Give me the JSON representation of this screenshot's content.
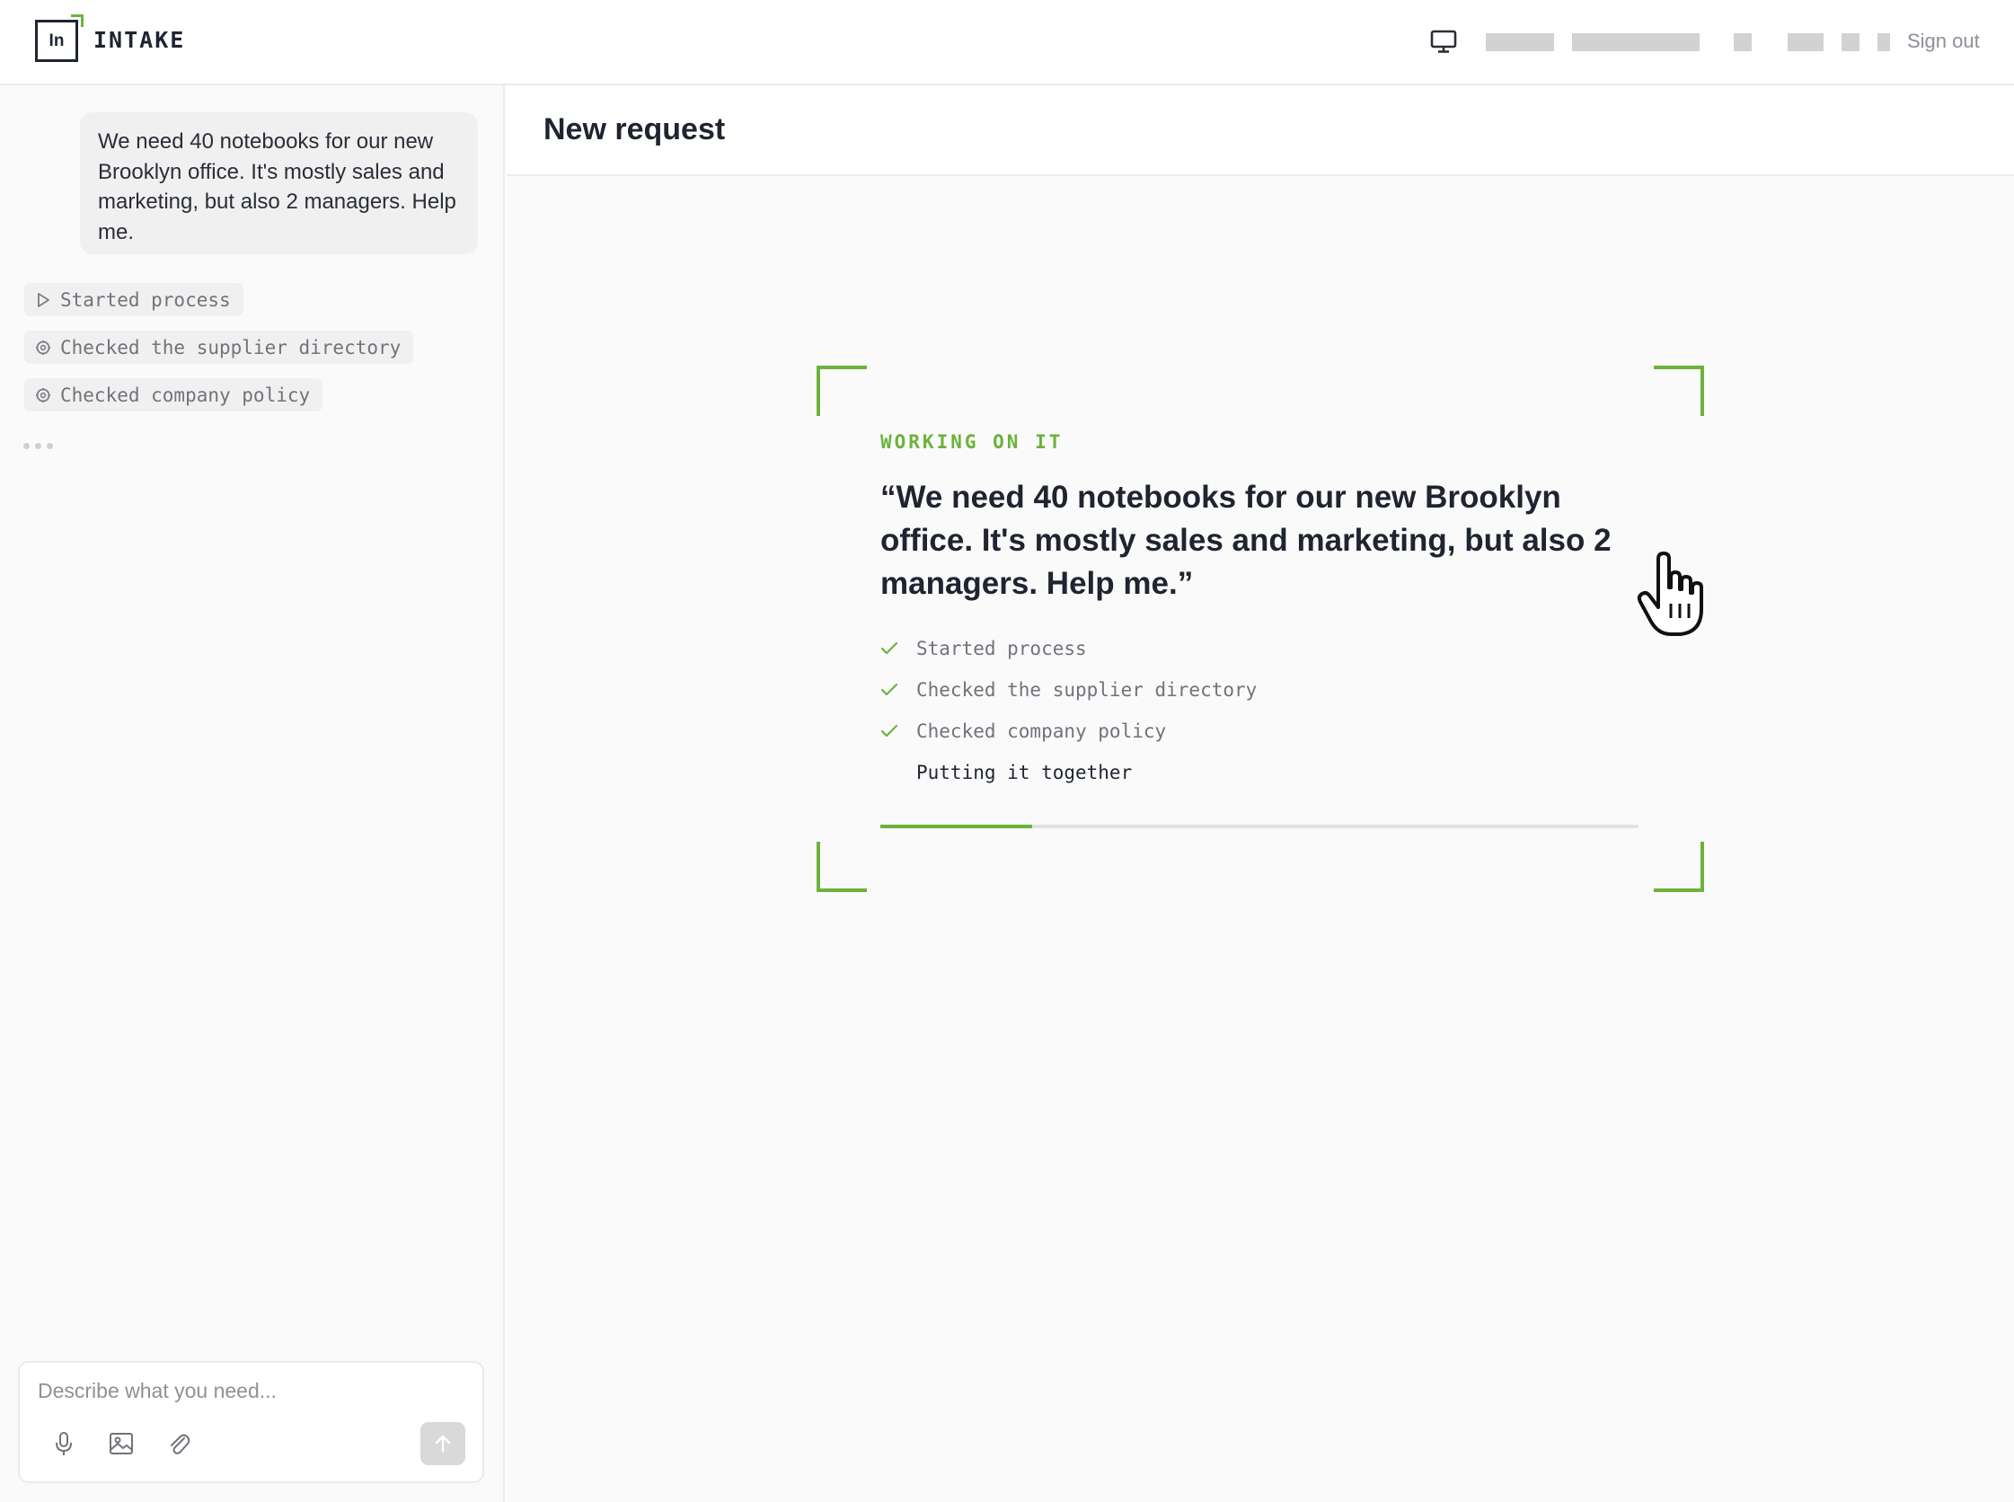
{
  "app": {
    "logo_text": "In",
    "brand": "INTAKE",
    "sign_out": "Sign out",
    "icons": {
      "display": "monitor-icon"
    }
  },
  "sidebar": {
    "user_message": "We need 40 notebooks for our new Brooklyn office. It's mostly sales and marketing, but also 2 managers. Help me.",
    "activity": [
      {
        "label": "Started process",
        "icon": "play-icon"
      },
      {
        "label": "Checked the supplier directory",
        "icon": "gear-icon"
      },
      {
        "label": "Checked company policy",
        "icon": "gear-icon"
      }
    ],
    "composer": {
      "placeholder": "Describe what you need...",
      "icons": [
        "microphone-icon",
        "image-icon",
        "paperclip-icon",
        "arrow-up-icon"
      ]
    }
  },
  "main": {
    "title": "New request",
    "status_label": "WORKING ON IT",
    "quote": "“We need 40 notebooks for our new Brooklyn office. It's mostly sales and marketing, but also 2 managers. Help me.”",
    "steps": [
      {
        "label": "Started process",
        "done": true
      },
      {
        "label": "Checked the supplier directory",
        "done": true
      },
      {
        "label": "Checked company policy",
        "done": true
      },
      {
        "label": "Putting it together",
        "done": false
      }
    ],
    "progress_fraction": 0.2
  },
  "colors": {
    "accent": "#6bb33b",
    "text": "#1f2430",
    "muted": "#6f737b"
  }
}
